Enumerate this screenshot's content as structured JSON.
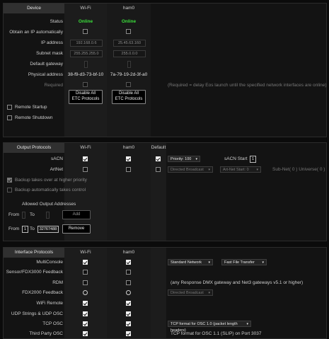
{
  "device": {
    "title": "Device",
    "columns": [
      "Wi-Fi",
      "ham0"
    ],
    "rows": {
      "status": "Status",
      "obtain_ip": "Obtain an IP automatically",
      "ip": "IP address",
      "subnet": "Subnet mask",
      "gateway": "Default gateway",
      "physical": "Physical address",
      "required": "Required"
    },
    "wifi": {
      "status": "Online",
      "ip": "192.168.0.6",
      "subnet": "255.255.255.0",
      "physical": "38-f9-d3-73-bf-10"
    },
    "ham0": {
      "status": "Online",
      "ip": "25.45.63.160",
      "subnet": "255.0.0.0",
      "physical": "7a-79-19-2d-3f-a0"
    },
    "required_note": "(Required = delay Eos launch until the specified network interfaces are online)",
    "disable_button_line1": "Disable All",
    "disable_button_line2": "ETC Protocols",
    "remote_startup": "Remote Startup",
    "remote_shutdown": "Remote Shutdown"
  },
  "output": {
    "title": "Output Protocols",
    "columns": [
      "Wi-Fi",
      "ham0",
      "Default"
    ],
    "sacn": "sACN",
    "artnet": "ArtNet",
    "priority": "Priority: 100",
    "sacn_start": "sACN Start",
    "sacn_start_value": "1",
    "directed_broadcast": "Directed Broadcast",
    "artnet_start": "Art-Net Start: 0",
    "subnet_universe": "Sub-Net( 0 ) Universe( 0 )",
    "backup_takes_over": "Backup takes over at higher priority",
    "backup_auto": "Backup automatically takes control",
    "allowed_title": "Allowed Output Addresses",
    "from": "From",
    "to": "To",
    "add": "Add",
    "from_value": "1",
    "to_value": "32767488",
    "remove": "Remove"
  },
  "interface": {
    "title": "Interface Protocols",
    "columns": [
      "Wi-Fi",
      "ham0"
    ],
    "rows": [
      "MultiConsole",
      "Sensor/FDX3000 Feedback",
      "RDM",
      "FDX2000 Feedback",
      "WiFi Remote",
      "UDP Strings & UDP OSC",
      "TCP OSC",
      "Third Party OSC"
    ],
    "standard_network": "Standard Network",
    "fast_file_transfer": "Fast File Transfer",
    "rdm_note": "(any Response DMX gateway and Net3 gateways v5.1 or higher)",
    "fdx_directed": "Directed Broadcast",
    "tcp_format": "TCP format for OSC 1.0 (packet length headers)",
    "third_party_note": "TCP format for OSC 1.1 (SLIP) on Port 3037"
  },
  "colors": {
    "online": "#3be03b",
    "header_bg": "#303030",
    "column_stripe": "#1c1c1c"
  }
}
